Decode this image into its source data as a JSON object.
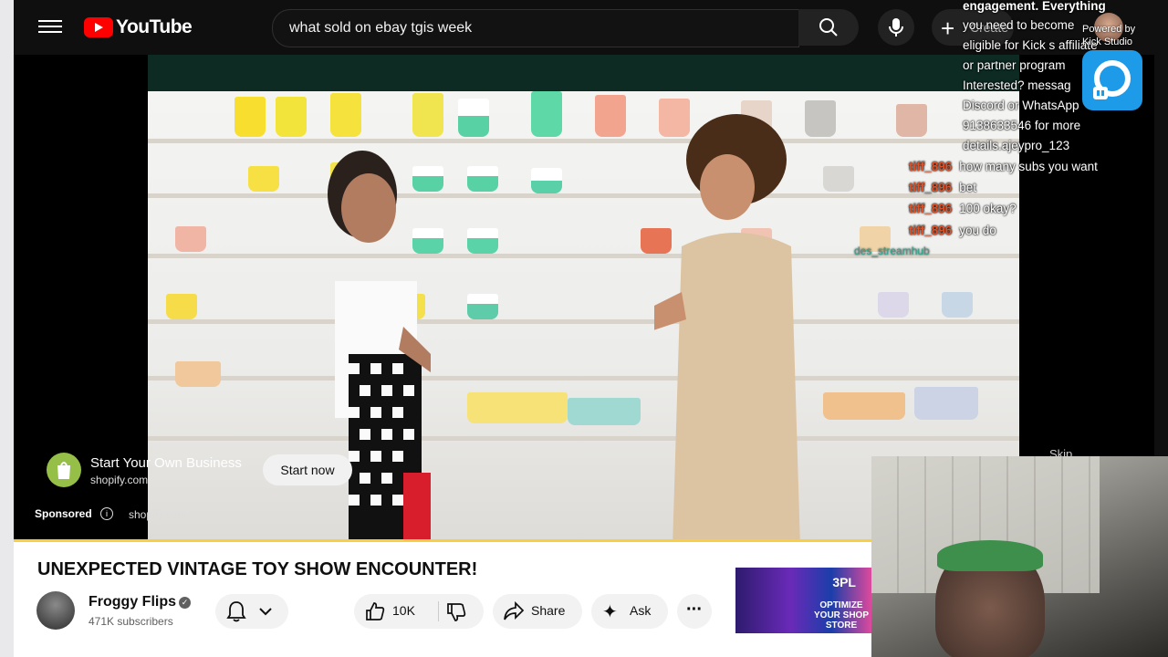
{
  "header": {
    "logo_text": "YouTube",
    "search_value": "what sold on ebay tgis week",
    "create_label": "Create",
    "icons": [
      "menu-icon",
      "search-icon",
      "mic-icon",
      "plus-icon",
      "bell-icon"
    ]
  },
  "ad": {
    "title": "Start Your Own Business",
    "domain": "shopify.com",
    "cta": "Start now",
    "sponsored": "Sponsored",
    "sponsored_domain": "shopify.com",
    "skip": "Skip"
  },
  "video": {
    "title": "UNEXPECTED VINTAGE TOY SHOW ENCOUNTER!",
    "channel": "Froggy Flips",
    "subscribers": "471K subscribers",
    "likes": "10K",
    "share": "Share",
    "ask": "Ask"
  },
  "related": {
    "badge": "3PL",
    "caption": "OPTIMIZE YOUR SHOP STORE"
  },
  "stream_overlay": {
    "powered_by": "Powered by",
    "studio": "Kick Studio",
    "announcement": [
      "engagement. Everything",
      "you need to become",
      "eligible for Kick s affiliate",
      "or partner program",
      "Interested? messag",
      "Discord or WhatsApp",
      "9138633546 for more",
      "details.ajeypro_123"
    ],
    "messages": [
      {
        "user": "tiff_896",
        "text": "how many subs you want"
      },
      {
        "user": "tiff_896",
        "text": "bet"
      },
      {
        "user": "tiff_896",
        "text": "100 okay?"
      },
      {
        "user": "tiff_896",
        "text": "you do"
      }
    ],
    "tag": "des_streamhub"
  }
}
